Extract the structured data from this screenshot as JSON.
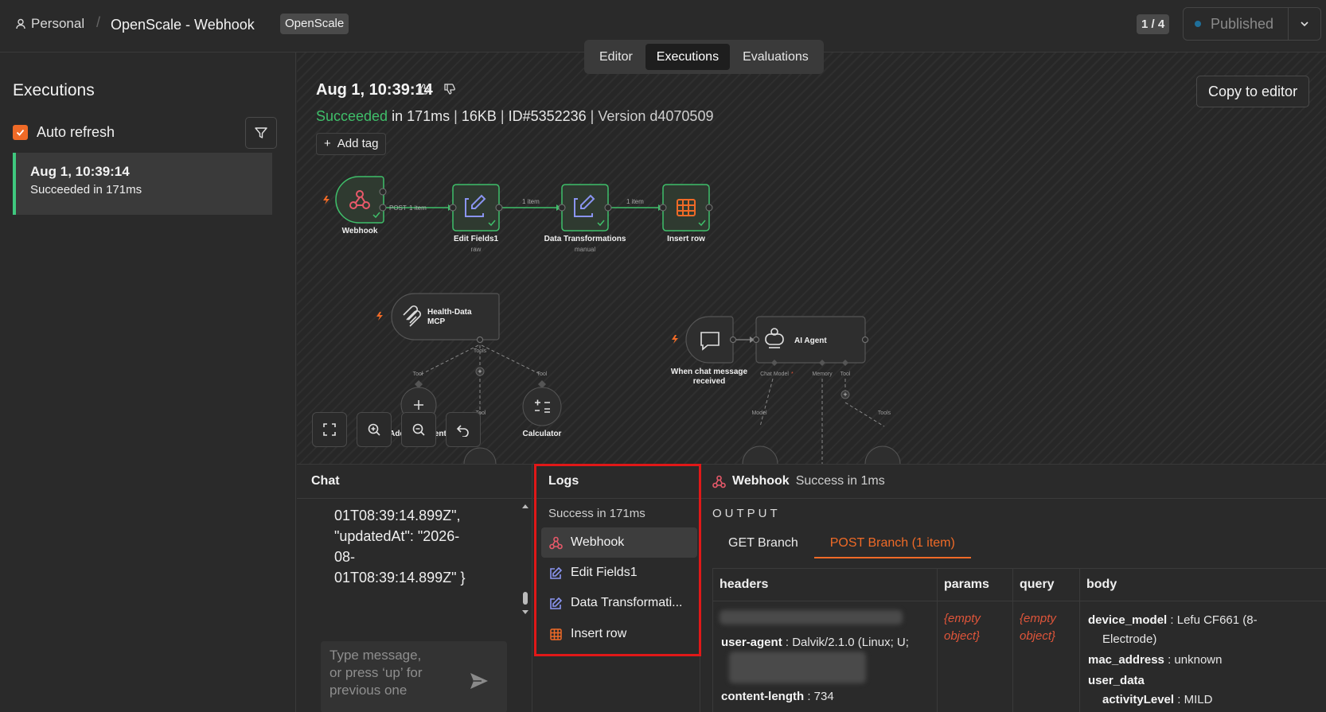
{
  "topbar": {
    "personal_label": "Personal",
    "separator": "/",
    "workflow_name": "OpenScale - Webhook",
    "project_badge": "OpenScale",
    "pager": "1 / 4",
    "publish_label": "Published"
  },
  "tabs": [
    "Editor",
    "Executions",
    "Evaluations"
  ],
  "sidebar": {
    "title": "Executions",
    "auto_refresh_label": "Auto refresh",
    "executions": [
      {
        "date": "Aug 1, 10:39:14",
        "status": "Succeeded in 171ms"
      }
    ]
  },
  "execution": {
    "date": "Aug 1, 10:39:14",
    "status": "Succeeded",
    "duration": "in 171ms",
    "size": "16KB",
    "id": "ID#5352236",
    "version": "Version d4070509",
    "add_tag": "Add tag",
    "copy_to_editor": "Copy to editor"
  },
  "flow": {
    "nodes": {
      "webhook": "Webhook",
      "edit_fields": "Edit Fields1",
      "edit_fields_sub": "raw",
      "data_transform": "Data Transformations",
      "data_transform_sub": "manual",
      "insert_row": "Insert row",
      "mcp_line1": "Health-Data",
      "mcp_line2": "MCP",
      "chat_trigger_line1": "When chat message",
      "chat_trigger_line2": "received",
      "ai_agent": "AI Agent",
      "add_event": "Add-new-event",
      "calculator": "Calculator"
    },
    "edges": {
      "post_label": "POST",
      "items_1": "1 item",
      "tools": "Tools",
      "tool": "Tool",
      "chat_model": "Chat Model",
      "memory": "Memory",
      "model": "Model"
    }
  },
  "chat": {
    "title": "Chat",
    "message": "01T08:39:14.899Z\",\n\"updatedAt\": \"2026-\n08-\n01T08:39:14.899Z\" }",
    "input_placeholder": "Type message, or press ‘up’ for previous one"
  },
  "logs": {
    "title": "Logs",
    "summary": "Success in 171ms",
    "items": [
      {
        "label": "Webhook",
        "icon": "webhook-icon"
      },
      {
        "label": "Edit Fields1",
        "icon": "edit-icon"
      },
      {
        "label": "Data Transformati...",
        "icon": "edit-icon"
      },
      {
        "label": "Insert row",
        "icon": "table-icon"
      }
    ]
  },
  "output": {
    "node": "Webhook",
    "status": "Success in 1ms",
    "label": "OUTPUT",
    "branches": [
      "GET Branch",
      "POST Branch (1 item)"
    ],
    "columns": [
      "headers",
      "params",
      "query",
      "body"
    ],
    "headers": [
      {
        "key": "user-agent",
        "value": "Dalvik/2.1.0 (Linux; U;"
      },
      {
        "key": "content-length",
        "value": "734"
      }
    ],
    "params_value": "{empty object}",
    "query_value": "{empty object}",
    "body": [
      {
        "key": "device_model",
        "value": "Lefu CF661 (8-",
        "cont": "Electrode)"
      },
      {
        "key": "mac_address",
        "value": "unknown"
      },
      {
        "key": "user_data",
        "value": ""
      },
      {
        "key": "activityLevel",
        "value": "MILD"
      }
    ]
  },
  "colors": {
    "accent": "#ef6a27",
    "success": "#3fbf6a",
    "highlight_box": "#e01818",
    "node_edit": "#8a94f0",
    "node_webhook": "#e8596a"
  }
}
